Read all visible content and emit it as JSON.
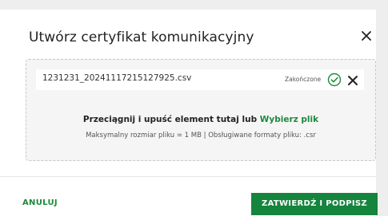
{
  "dialog": {
    "title": "Utwórz certyfikat komunikacyjny",
    "close_icon": "close-icon"
  },
  "upload": {
    "file_name": "1231231_20241117215127925.csv",
    "status": "Zakończone",
    "status_icon": "check-circle-icon",
    "remove_icon": "close-icon",
    "drop_text": "Przeciągnij i upuść element tutaj lub",
    "browse_link": "Wybierz plik",
    "hint": "Maksymalny rozmiar pliku = 1 MB | Obsługiwane formaty pliku: .csr"
  },
  "footer": {
    "cancel_label": "ANULUJ",
    "confirm_label": "ZATWIERDŹ I PODPISZ"
  },
  "colors": {
    "accent": "#15843d",
    "dropzone_bg": "#f5f5f5"
  }
}
